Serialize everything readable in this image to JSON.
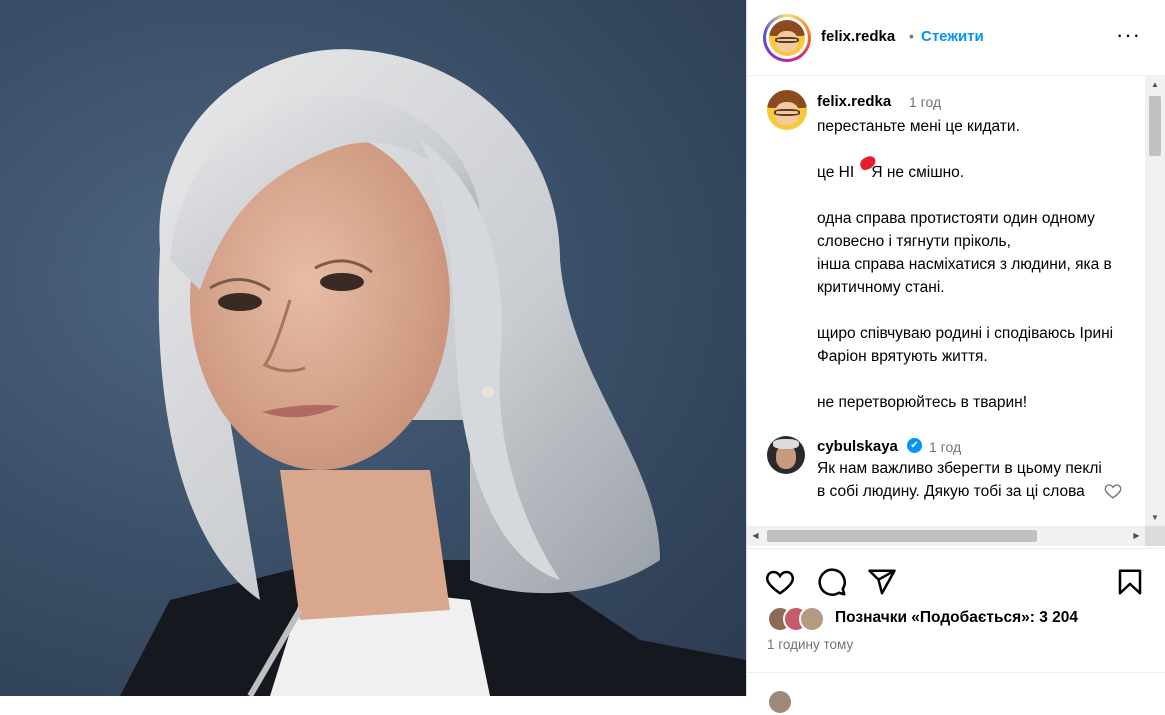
{
  "post": {
    "image": {
      "description_icon": "photo-portrait"
    },
    "header": {
      "username": "felix.redka",
      "separator": "•",
      "follow_label": "Стежити",
      "more_icon": "more-horizontal-icon",
      "more_label": "···"
    },
    "caption": {
      "username": "felix.redka",
      "time": "1 год",
      "text": "перестаньте мені це кидати.\n\nце НІ    Я не смішно.\n\nодна справа протистояти один одному словесно і тягнути пріколь,\nінша справа насміхатися з людини, яка в критичному стані.\n\nщиро співчуваю родині і сподіваюсь Ірині Фаріон врятують життя.\n\nне перетворюйтесь в тварин!"
    },
    "comment": {
      "username": "cybulskaya",
      "verified_mark": "✔",
      "time": "1 год",
      "text": "Як нам важливо зберегти в цьому пеклі в собі людину. Дякую тобі за ці слова"
    },
    "actions": {
      "like_icon": "heart-icon",
      "comment_icon": "comment-icon",
      "share_icon": "send-icon",
      "save_icon": "bookmark-icon"
    },
    "likes_text": "Позначки «Подобається»: 3 204",
    "post_time": "1 годину тому",
    "scrollbar": {
      "up": "▲",
      "down": "▼",
      "left": "◀",
      "right": "▶"
    },
    "colors": {
      "follow": "#0095f6",
      "muted": "#737373",
      "verified": "#0095f6"
    }
  }
}
